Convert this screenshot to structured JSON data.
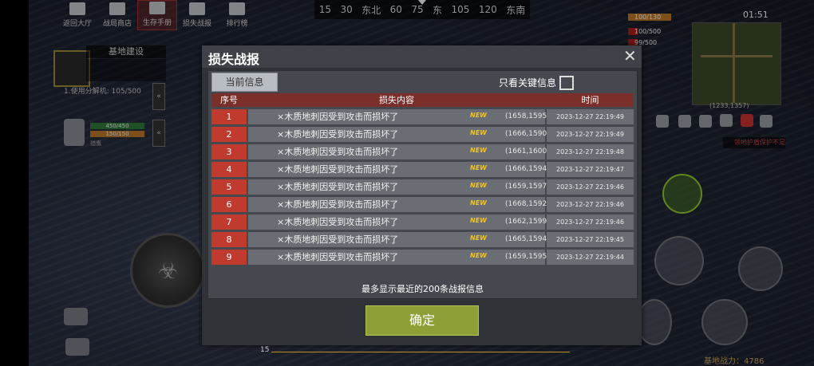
{
  "topnav": {
    "items": [
      "返回大厅",
      "战局商店",
      "生存手册",
      "损失战报",
      "排行榜"
    ]
  },
  "compass": [
    "15",
    "30",
    "东北",
    "60",
    "75",
    "东",
    "105",
    "120",
    "东南"
  ],
  "base": {
    "title": "基地建设",
    "dismantle_text": "1.使用分解机: 105/500",
    "tab_arrow": "«"
  },
  "pet": {
    "hp": "450/450",
    "energy": "150/150",
    "name": "猎鹰"
  },
  "hud": {
    "clock": "01:51",
    "hp": "100/130",
    "food": "100/500",
    "water": "99/500",
    "coord": "(1233,1357)",
    "warning": "领地护盾保护不足",
    "power_label": "基地战力：4786"
  },
  "dialog": {
    "title": "损失战报",
    "close": "✕",
    "tab_current": "当前信息",
    "only_key_label": "只看关键信息",
    "columns": [
      "序号",
      "损失内容",
      "时间"
    ],
    "rows": [
      {
        "idx": "1",
        "msg": "×木质地刺因受到攻击而损坏了",
        "new": "NEW",
        "pos": "(1658,1595)",
        "time": "2023-12-27 22:19:49"
      },
      {
        "idx": "2",
        "msg": "×木质地刺因受到攻击而损坏了",
        "new": "NEW",
        "pos": "(1666,1590)",
        "time": "2023-12-27 22:19:49"
      },
      {
        "idx": "3",
        "msg": "×木质地刺因受到攻击而损坏了",
        "new": "NEW",
        "pos": "(1661,1600)",
        "time": "2023-12-27 22:19:48"
      },
      {
        "idx": "4",
        "msg": "×木质地刺因受到攻击而损坏了",
        "new": "NEW",
        "pos": "(1666,1594)",
        "time": "2023-12-27 22:19:47"
      },
      {
        "idx": "5",
        "msg": "×木质地刺因受到攻击而损坏了",
        "new": "NEW",
        "pos": "(1659,1597)",
        "time": "2023-12-27 22:19:46"
      },
      {
        "idx": "6",
        "msg": "×木质地刺因受到攻击而损坏了",
        "new": "NEW",
        "pos": "(1668,1592)",
        "time": "2023-12-27 22:19:46"
      },
      {
        "idx": "7",
        "msg": "×木质地刺因受到攻击而损坏了",
        "new": "NEW",
        "pos": "(1662,1599)",
        "time": "2023-12-27 22:19:46"
      },
      {
        "idx": "8",
        "msg": "×木质地刺因受到攻击而损坏了",
        "new": "NEW",
        "pos": "(1665,1594)",
        "time": "2023-12-27 22:19:45"
      },
      {
        "idx": "9",
        "msg": "×木质地刺因受到攻击而损坏了",
        "new": "NEW",
        "pos": "(1659,1595)",
        "time": "2023-12-27 22:19:44"
      }
    ],
    "footer_note": "最多显示最近的200条战报信息",
    "confirm": "确定"
  },
  "bottom_number": "15",
  "colors": {
    "header_red": "#7a2f2a",
    "index_red": "#c03a2e",
    "confirm_green": "#8f9f38",
    "new_yellow": "#e8c23a"
  }
}
